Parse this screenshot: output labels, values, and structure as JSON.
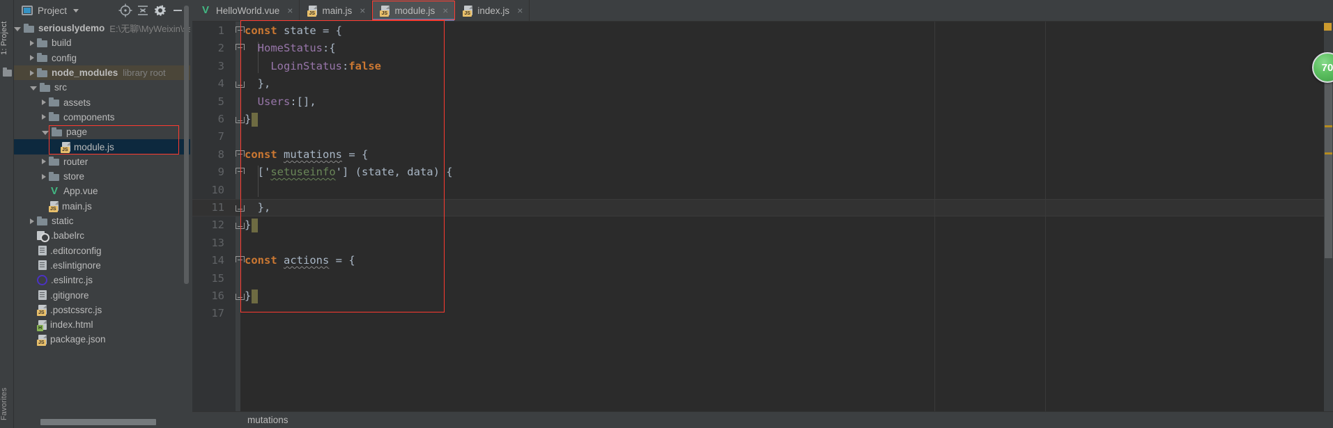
{
  "window": {
    "tool_stripe_left": "1: Project",
    "tool_stripe_bottom": "Favorites"
  },
  "project_panel": {
    "title": "Project",
    "icons": [
      "project-icon",
      "chevron-down-icon",
      "locate-icon",
      "collapse-all-icon",
      "gear-icon",
      "minimize-icon"
    ],
    "tree": [
      {
        "label": "seriouslydemo",
        "sub": "E:\\无聊\\MyWeixin\\se",
        "icon": "folder-icon",
        "twist": "open",
        "indent": 0,
        "bold": true,
        "state": "normal"
      },
      {
        "label": "build",
        "sub": "",
        "icon": "folder-icon",
        "twist": "closed",
        "indent": 1,
        "bold": false,
        "state": "normal"
      },
      {
        "label": "config",
        "sub": "",
        "icon": "folder-icon",
        "twist": "closed",
        "indent": 1,
        "bold": false,
        "state": "normal"
      },
      {
        "label": "node_modules",
        "sub": "library root",
        "icon": "folder-icon",
        "twist": "closed",
        "indent": 1,
        "bold": true,
        "state": "library"
      },
      {
        "label": "src",
        "sub": "",
        "icon": "folder-icon",
        "twist": "open",
        "indent": 1,
        "bold": false,
        "state": "normal"
      },
      {
        "label": "assets",
        "sub": "",
        "icon": "folder-icon",
        "twist": "closed",
        "indent": 2,
        "bold": false,
        "state": "normal"
      },
      {
        "label": "components",
        "sub": "",
        "icon": "folder-icon",
        "twist": "closed",
        "indent": 2,
        "bold": false,
        "state": "normal"
      },
      {
        "label": "page",
        "sub": "",
        "icon": "folder-icon",
        "twist": "open",
        "indent": 2,
        "bold": false,
        "state": "normal"
      },
      {
        "label": "module.js",
        "sub": "",
        "icon": "js-file-icon",
        "twist": "none",
        "indent": 3,
        "bold": false,
        "state": "selected"
      },
      {
        "label": "router",
        "sub": "",
        "icon": "folder-icon",
        "twist": "closed",
        "indent": 2,
        "bold": false,
        "state": "normal"
      },
      {
        "label": "store",
        "sub": "",
        "icon": "folder-icon",
        "twist": "closed",
        "indent": 2,
        "bold": false,
        "state": "normal"
      },
      {
        "label": "App.vue",
        "sub": "",
        "icon": "vue-file-icon",
        "twist": "none",
        "indent": 2,
        "bold": false,
        "state": "normal"
      },
      {
        "label": "main.js",
        "sub": "",
        "icon": "js-file-icon",
        "twist": "none",
        "indent": 2,
        "bold": false,
        "state": "normal"
      },
      {
        "label": "static",
        "sub": "",
        "icon": "folder-icon",
        "twist": "closed",
        "indent": 1,
        "bold": false,
        "state": "normal"
      },
      {
        "label": ".babelrc",
        "sub": "",
        "icon": "babel-file-icon",
        "twist": "none",
        "indent": 1,
        "bold": false,
        "state": "normal"
      },
      {
        "label": ".editorconfig",
        "sub": "",
        "icon": "text-file-icon",
        "twist": "none",
        "indent": 1,
        "bold": false,
        "state": "normal"
      },
      {
        "label": ".eslintignore",
        "sub": "",
        "icon": "text-file-icon",
        "twist": "none",
        "indent": 1,
        "bold": false,
        "state": "normal"
      },
      {
        "label": ".eslintrc.js",
        "sub": "",
        "icon": "eslint-file-icon",
        "twist": "none",
        "indent": 1,
        "bold": false,
        "state": "normal"
      },
      {
        "label": ".gitignore",
        "sub": "",
        "icon": "text-file-icon",
        "twist": "none",
        "indent": 1,
        "bold": false,
        "state": "normal"
      },
      {
        "label": ".postcssrc.js",
        "sub": "",
        "icon": "js-file-icon",
        "twist": "none",
        "indent": 1,
        "bold": false,
        "state": "normal"
      },
      {
        "label": "index.html",
        "sub": "",
        "icon": "html-file-icon",
        "twist": "none",
        "indent": 1,
        "bold": false,
        "state": "normal"
      },
      {
        "label": "package.json",
        "sub": "",
        "icon": "json-file-icon",
        "twist": "none",
        "indent": 1,
        "bold": false,
        "state": "normal"
      }
    ]
  },
  "tabs": [
    {
      "label": "HelloWorld.vue",
      "icon": "vue-file-icon",
      "active": false,
      "close": "×"
    },
    {
      "label": "main.js",
      "icon": "js-file-icon",
      "active": false,
      "close": "×"
    },
    {
      "label": "module.js",
      "icon": "js-file-icon",
      "active": true,
      "close": "×"
    },
    {
      "label": "index.js",
      "icon": "js-file-icon",
      "active": false,
      "close": "×"
    }
  ],
  "editor": {
    "line_numbers": [
      "1",
      "2",
      "3",
      "4",
      "5",
      "6",
      "7",
      "8",
      "9",
      "10",
      "11",
      "12",
      "13",
      "14",
      "15",
      "16",
      "17"
    ],
    "lines": [
      {
        "n": 1,
        "tokens": [
          {
            "t": "const ",
            "c": "kw"
          },
          {
            "t": "state ",
            "c": "plain"
          },
          {
            "t": "= {",
            "c": "plain"
          }
        ]
      },
      {
        "n": 2,
        "tokens": [
          {
            "t": "  ",
            "c": "plain"
          },
          {
            "t": "HomeStatus",
            "c": "prop"
          },
          {
            "t": ":{",
            "c": "plain"
          }
        ]
      },
      {
        "n": 3,
        "tokens": [
          {
            "t": "    ",
            "c": "plain"
          },
          {
            "t": "LoginStatus",
            "c": "prop"
          },
          {
            "t": ":",
            "c": "plain"
          },
          {
            "t": "false",
            "c": "kw"
          }
        ]
      },
      {
        "n": 4,
        "tokens": [
          {
            "t": "  },",
            "c": "plain"
          }
        ]
      },
      {
        "n": 5,
        "tokens": [
          {
            "t": "  ",
            "c": "plain"
          },
          {
            "t": "Users",
            "c": "prop"
          },
          {
            "t": ":[],",
            "c": "plain"
          }
        ]
      },
      {
        "n": 6,
        "tokens": [
          {
            "t": "}",
            "c": "plain"
          }
        ]
      },
      {
        "n": 7,
        "tokens": []
      },
      {
        "n": 8,
        "tokens": [
          {
            "t": "const ",
            "c": "kw"
          },
          {
            "t": "mutations",
            "c": "wavy-gray"
          },
          {
            "t": " = {",
            "c": "plain"
          }
        ]
      },
      {
        "n": 9,
        "tokens": [
          {
            "t": "  ['",
            "c": "plain"
          },
          {
            "t": "setuseinfo",
            "c": "wavy-green"
          },
          {
            "t": "'] (state, data) {",
            "c": "plain"
          }
        ]
      },
      {
        "n": 10,
        "tokens": []
      },
      {
        "n": 11,
        "tokens": [
          {
            "t": "  },",
            "c": "plain"
          }
        ]
      },
      {
        "n": 12,
        "tokens": [
          {
            "t": "}",
            "c": "plain"
          }
        ]
      },
      {
        "n": 13,
        "tokens": []
      },
      {
        "n": 14,
        "tokens": [
          {
            "t": "const ",
            "c": "kw"
          },
          {
            "t": "actions",
            "c": "wavy-gray"
          },
          {
            "t": " = {",
            "c": "plain"
          }
        ]
      },
      {
        "n": 15,
        "tokens": []
      },
      {
        "n": 16,
        "tokens": [
          {
            "t": "}",
            "c": "plain"
          }
        ]
      },
      {
        "n": 17,
        "tokens": []
      }
    ],
    "caret_line": 11,
    "fold_placeholder_lines": [
      6,
      12,
      16
    ],
    "fold_start_lines": [
      1,
      2,
      8,
      9,
      14
    ],
    "fold_end_lines": [
      4,
      6,
      11,
      12,
      16
    ],
    "breadcrumb": "mutations"
  },
  "markers": {
    "inspection_badge": "70",
    "badge_color": "#5cbf60",
    "warning_stripe_color": "#b58b1e",
    "top_marker_color": "#cc9a2e"
  },
  "annotations": {
    "color": "#ff3b30",
    "regions": [
      "tree-page-module",
      "tab-module-js",
      "code-block"
    ]
  }
}
